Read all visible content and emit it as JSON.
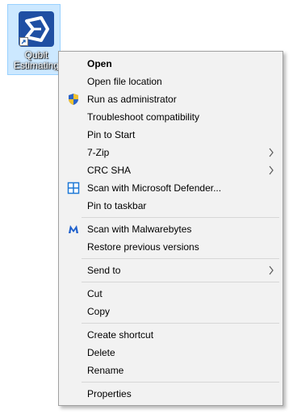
{
  "desktop_icon": {
    "label": "Qubit\nEstimating",
    "icon": "qubit-app-icon"
  },
  "context_menu": {
    "items": [
      {
        "label": "Open"
      },
      {
        "label": "Open file location"
      },
      {
        "label": "Run as administrator",
        "icon": "uac-shield-icon"
      },
      {
        "label": "Troubleshoot compatibility"
      },
      {
        "label": "Pin to Start"
      },
      {
        "label": "7-Zip"
      },
      {
        "label": "CRC SHA"
      },
      {
        "label": "Scan with Microsoft Defender...",
        "icon": "defender-icon"
      },
      {
        "label": "Pin to taskbar"
      },
      {
        "label": "Scan with Malwarebytes",
        "icon": "malwarebytes-icon"
      },
      {
        "label": "Restore previous versions"
      },
      {
        "label": "Send to"
      },
      {
        "label": "Cut"
      },
      {
        "label": "Copy"
      },
      {
        "label": "Create shortcut"
      },
      {
        "label": "Delete"
      },
      {
        "label": "Rename"
      },
      {
        "label": "Properties"
      }
    ]
  }
}
